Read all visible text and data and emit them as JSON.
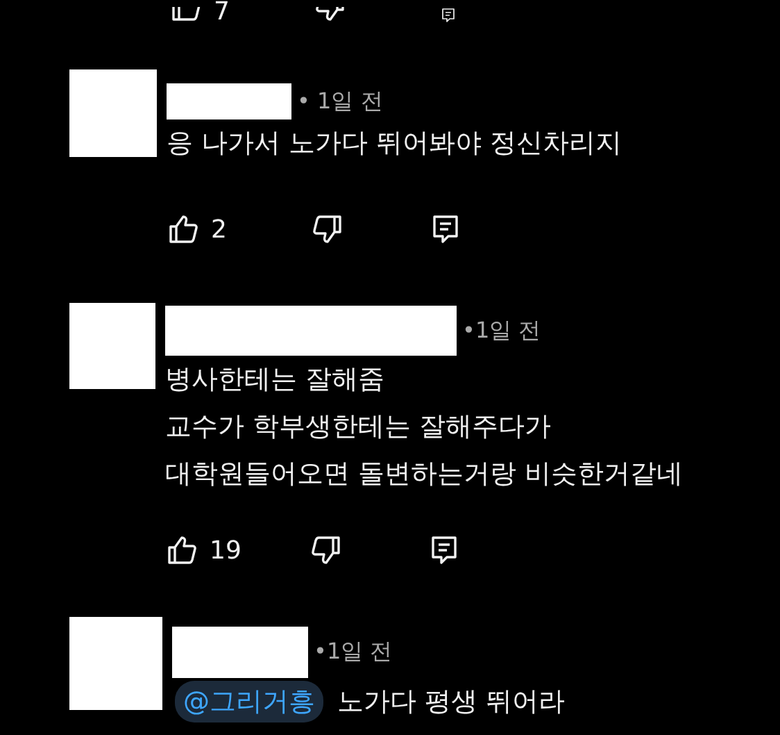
{
  "top_actions": {
    "likes": "7"
  },
  "comments": [
    {
      "time": "• 1일 전",
      "lines": [
        "응 나가서 노가다 뛰어봐야 정신차리지"
      ],
      "likes": "2"
    },
    {
      "time": "•1일 전",
      "lines": [
        "병사한테는 잘해줌",
        "교수가 학부생한테는 잘해주다가",
        "대학원들어오면 돌변하는거랑 비슷한거같네"
      ],
      "likes": "19"
    },
    {
      "time": "•1일 전",
      "mention": "@그리거흥",
      "lines": [
        "노가다 평생 뛰어라"
      ]
    }
  ]
}
